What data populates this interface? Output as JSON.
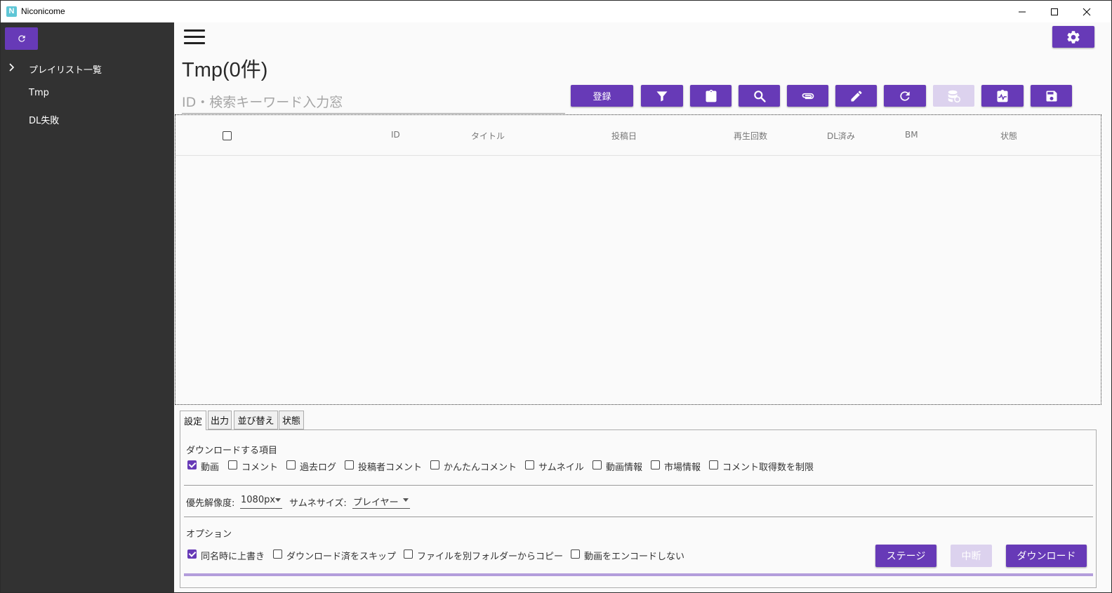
{
  "window": {
    "app_title": "Niconicome",
    "app_icon_letter": "N"
  },
  "sidebar": {
    "items": [
      {
        "label": "プレイリスト一覧"
      },
      {
        "label": "Tmp"
      },
      {
        "label": "DL失敗"
      }
    ]
  },
  "main": {
    "title": "Tmp(0件)",
    "search": {
      "placeholder": "ID・検索キーワード入力窓",
      "value": ""
    },
    "toolbar": {
      "register_label": "登録",
      "icons": [
        "filter-icon",
        "clipboard-icon",
        "search-icon",
        "paperclip-icon",
        "pencil-icon",
        "refresh-icon",
        "database-sync-icon",
        "clipboard-pulse-icon",
        "save-icon"
      ]
    },
    "grid": {
      "columns": [
        "ID",
        "タイトル",
        "投稿日",
        "再生回数",
        "DL済み",
        "BM",
        "状態"
      ],
      "rows": []
    }
  },
  "bottom": {
    "tabs": [
      {
        "label": "設定",
        "active": true
      },
      {
        "label": "出力",
        "active": false
      },
      {
        "label": "並び替え",
        "active": false
      },
      {
        "label": "状態",
        "active": false
      }
    ],
    "download_items_label": "ダウンロードする項目",
    "download_items": [
      {
        "label": "動画",
        "checked": true
      },
      {
        "label": "コメント",
        "checked": false
      },
      {
        "label": "過去ログ",
        "checked": false
      },
      {
        "label": "投稿者コメント",
        "checked": false
      },
      {
        "label": "かんたんコメント",
        "checked": false
      },
      {
        "label": "サムネイル",
        "checked": false
      },
      {
        "label": "動画情報",
        "checked": false
      },
      {
        "label": "市場情報",
        "checked": false
      },
      {
        "label": "コメント取得数を制限",
        "checked": false
      }
    ],
    "resolution_label": "優先解像度:",
    "resolution_value": "1080px",
    "thumb_label": "サムネサイズ:",
    "thumb_value": "プレイヤー",
    "options_label": "オプション",
    "options": [
      {
        "label": "同名時に上書き",
        "checked": true
      },
      {
        "label": "ダウンロード済をスキップ",
        "checked": false
      },
      {
        "label": "ファイルを別フォルダーからコピー",
        "checked": false
      },
      {
        "label": "動画をエンコードしない",
        "checked": false
      }
    ],
    "stage_label": "ステージ",
    "cancel_label": "中断",
    "download_label": "ダウンロード",
    "progress": 0
  },
  "colors": {
    "accent": "#673ab7",
    "accent_disabled": "#dcd2ee",
    "sidebar_bg": "#323232"
  }
}
